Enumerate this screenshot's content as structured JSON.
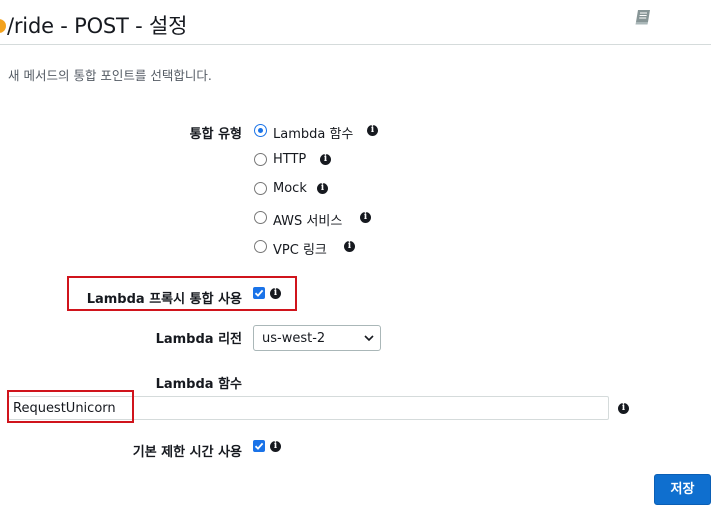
{
  "header": {
    "title": "/ride - POST - 설정",
    "docs_icon": "book-icon"
  },
  "subtitle": "새 메서드의 통합 포인트를 선택합니다.",
  "integration_type": {
    "label": "통합 유형",
    "options": [
      {
        "label": "Lambda 함수",
        "selected": true
      },
      {
        "label": "HTTP",
        "selected": false
      },
      {
        "label": "Mock",
        "selected": false
      },
      {
        "label": "AWS 서비스",
        "selected": false
      },
      {
        "label": "VPC 링크",
        "selected": false
      }
    ]
  },
  "proxy": {
    "label": "Lambda 프록시 통합 사용",
    "checked": true
  },
  "region": {
    "label": "Lambda 리전",
    "value": "us-west-2"
  },
  "function": {
    "label": "Lambda 함수",
    "value": "RequestUnicorn"
  },
  "default_timeout": {
    "label": "기본 제한 시간 사용",
    "checked": true
  },
  "save_label": "저장",
  "colors": {
    "accent": "#1a73e8",
    "highlight": "#d0141c",
    "save_button": "#0f6fcf"
  }
}
